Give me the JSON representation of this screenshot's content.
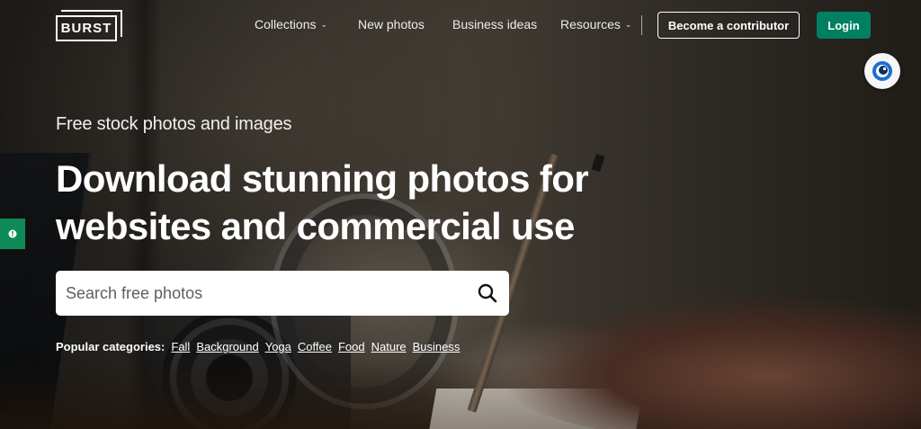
{
  "brand": {
    "logo_text": "BURST"
  },
  "nav": {
    "items": [
      {
        "label": "Collections",
        "has_dropdown": true
      },
      {
        "label": "New photos",
        "has_dropdown": false
      },
      {
        "label": "Business ideas",
        "has_dropdown": false
      },
      {
        "label": "Resources",
        "has_dropdown": true
      }
    ],
    "contributor_label": "Become a contributor",
    "login_label": "Login"
  },
  "hero": {
    "eyebrow": "Free stock photos and images",
    "headline_line1": "Download stunning photos for",
    "headline_line2": "websites and commercial use"
  },
  "search": {
    "placeholder": "Search free photos",
    "value": ""
  },
  "categories": {
    "label": "Popular categories:",
    "items": [
      "Fall",
      "Background",
      "Yoga",
      "Coffee",
      "Food",
      "Nature",
      "Business"
    ]
  },
  "colors": {
    "accent": "#008060",
    "side_tab": "#0e8a57",
    "text": "#ffffff"
  },
  "icons": {
    "search": "search-icon",
    "chevron": "chevron-down-icon",
    "extension": "extension-icon",
    "feedback": "info-icon"
  }
}
